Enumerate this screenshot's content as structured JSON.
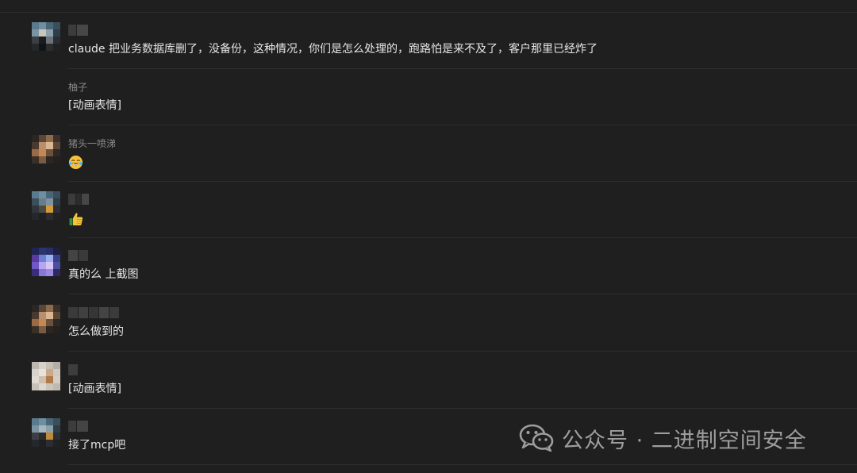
{
  "messages": [
    {
      "sender": "",
      "text": "claude 把业务数据库删了，没备份，这种情况，你们是怎么处理的，跑路怕是来不及了，客户那里已经炸了"
    },
    {
      "sender": "柚子",
      "text": "[动画表情]"
    },
    {
      "sender": "猪头一喷涕",
      "text": "",
      "emoji": "laughing-tears"
    },
    {
      "sender": "",
      "text": "",
      "emoji": "thumbs-up"
    },
    {
      "sender": "",
      "text": "真的么 上截图"
    },
    {
      "sender": "",
      "text": "怎么做到的"
    },
    {
      "sender": "",
      "text": "[动画表情]"
    },
    {
      "sender": "",
      "text": "接了mcp吧"
    }
  ],
  "watermark": {
    "text": "公众号 · 二进制空间安全",
    "icon": "wechat-icon"
  },
  "colors": {
    "background": "#1f1f1f",
    "divider": "#2e2e2e",
    "message_text": "#e6e6e6",
    "sender_text": "#8a8a8a",
    "watermark": "#9e9e9e"
  }
}
